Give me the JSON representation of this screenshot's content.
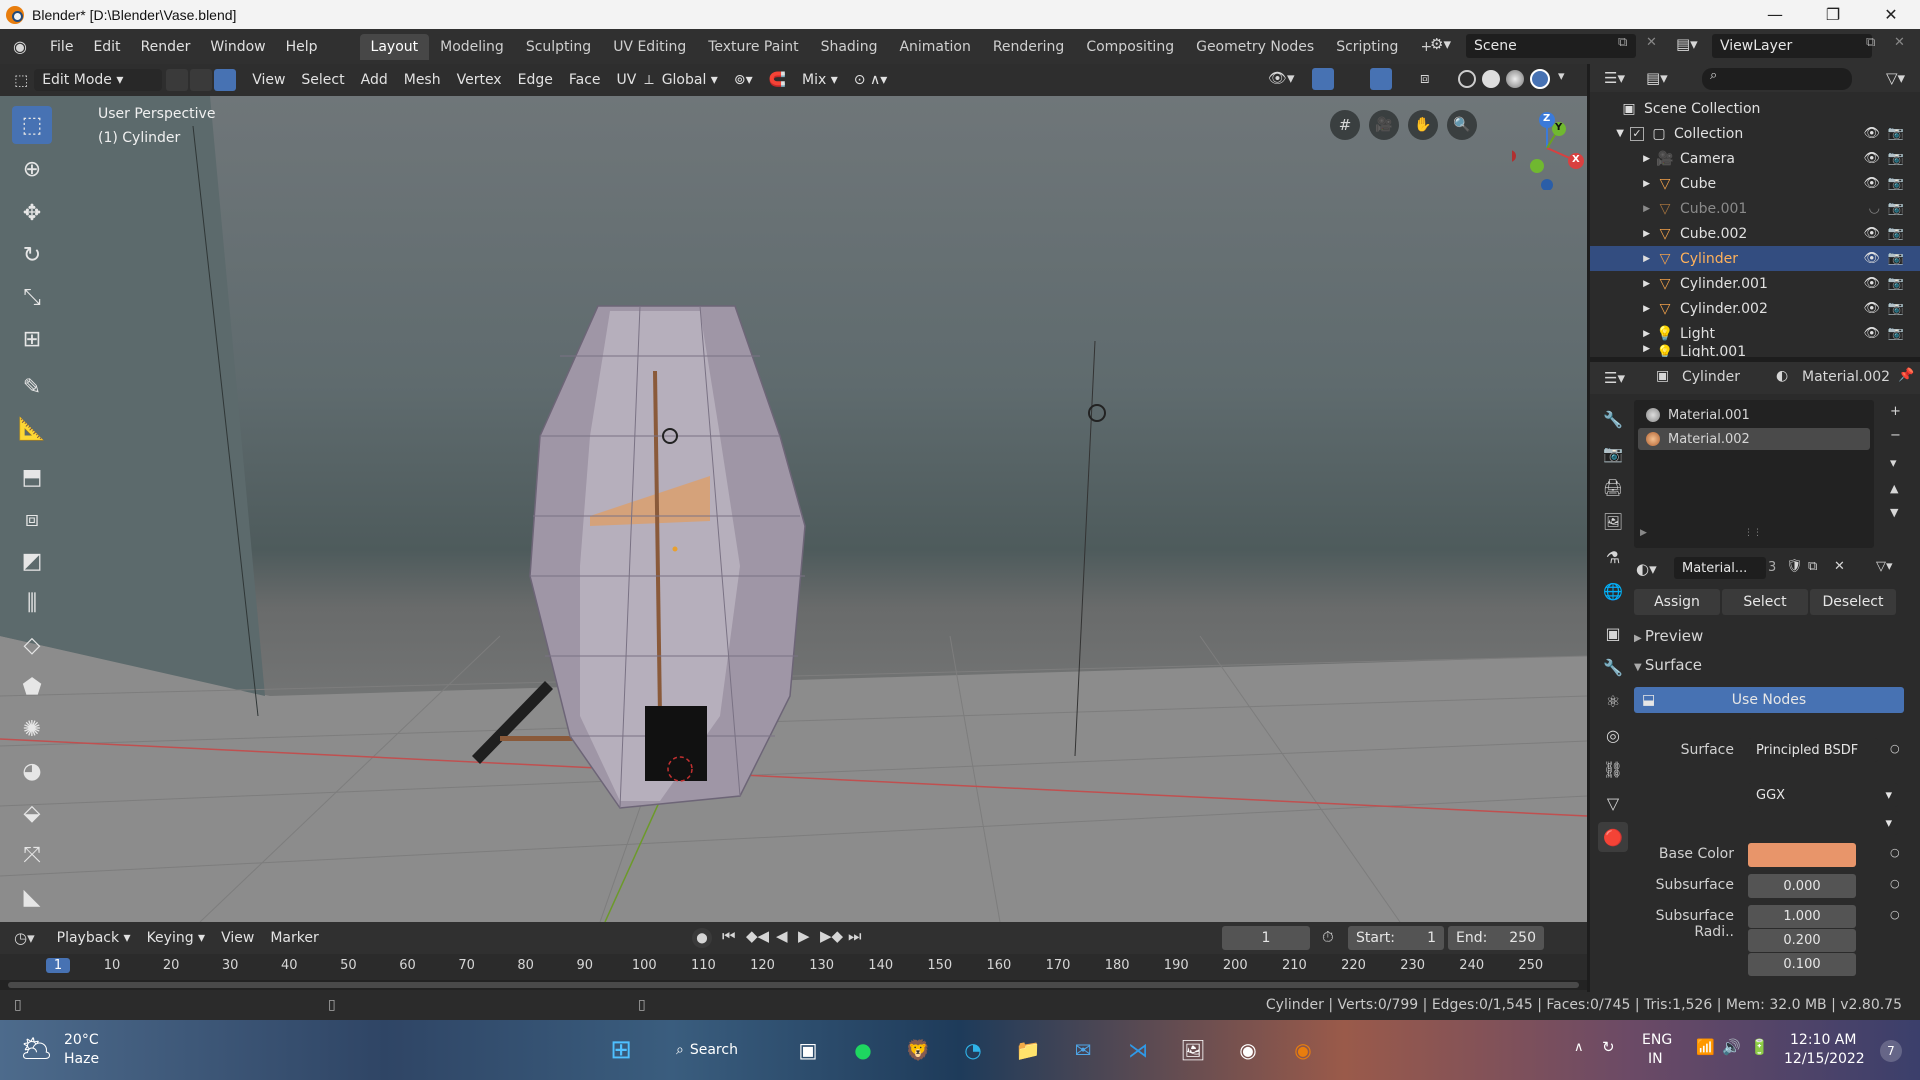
{
  "titlebar": {
    "title": "Blender* [D:\\Blender\\Vase.blend]",
    "minimize": "—",
    "maximize": "❐",
    "close": "✕"
  },
  "menu": [
    "File",
    "Edit",
    "Render",
    "Window",
    "Help"
  ],
  "workspaces": [
    "Layout",
    "Modeling",
    "Sculpting",
    "UV Editing",
    "Texture Paint",
    "Shading",
    "Animation",
    "Rendering",
    "Compositing",
    "Geometry Nodes",
    "Scripting"
  ],
  "add_workspace": "+",
  "scene": {
    "name": "Scene"
  },
  "view_layer": {
    "name": "ViewLayer"
  },
  "editor_header": {
    "mode": "Edit Mode",
    "menus": [
      "View",
      "Select",
      "Add",
      "Mesh",
      "Vertex",
      "Edge",
      "Face",
      "UV"
    ],
    "orientation": "Global",
    "proportional": "Mix"
  },
  "viewport": {
    "perspective": "User Perspective",
    "object": "(1) Cylinder"
  },
  "gizmo": {
    "z": "Z",
    "y": "Y",
    "x": "X"
  },
  "outliner": {
    "search_icon": "search-icon",
    "scene_collection": "Scene Collection",
    "collection": "Collection",
    "items": [
      {
        "name": "Camera",
        "icon": "camera-icon"
      },
      {
        "name": "Cube",
        "icon": "mesh-icon"
      },
      {
        "name": "Cube.001",
        "icon": "mesh-icon"
      },
      {
        "name": "Cube.002",
        "icon": "mesh-icon"
      },
      {
        "name": "Cylinder",
        "icon": "mesh-icon"
      },
      {
        "name": "Cylinder.001",
        "icon": "mesh-icon"
      },
      {
        "name": "Cylinder.002",
        "icon": "mesh-icon"
      },
      {
        "name": "Light",
        "icon": "light-icon"
      },
      {
        "name": "Light.001",
        "icon": "light-icon"
      }
    ]
  },
  "properties": {
    "object": "Cylinder",
    "material": "Material.002",
    "slots": [
      "Material.001",
      "Material.002"
    ],
    "material_field": "Material...",
    "user_count": "3",
    "assign": "Assign",
    "select": "Select",
    "deselect": "Deselect",
    "preview": "Preview",
    "surface_section": "Surface",
    "use_nodes": "Use Nodes",
    "surface_label": "Surface",
    "surface_value": "Principled BSDF",
    "distribution": "GGX",
    "base_color_label": "Base Color",
    "base_color": "#e8956a",
    "subsurface_label": "Subsurface",
    "subsurface_value": "0.000",
    "subsurface_radius_label": "Subsurface Radi..",
    "subsurface_radius": [
      "1.000",
      "0.200",
      "0.100"
    ]
  },
  "timeline": {
    "menus": [
      "Playback",
      "Keying",
      "View",
      "Marker"
    ],
    "current_frame": "1",
    "start_label": "Start:",
    "start": "1",
    "end_label": "End:",
    "end": "250",
    "ruler": [
      "1",
      "10",
      "20",
      "30",
      "40",
      "50",
      "60",
      "70",
      "80",
      "90",
      "100",
      "110",
      "120",
      "130",
      "140",
      "150",
      "160",
      "170",
      "180",
      "190",
      "200",
      "210",
      "220",
      "230",
      "240",
      "250"
    ]
  },
  "statusbar": {
    "info": "Cylinder | Verts:0/799 | Edges:0/1,545 | Faces:0/745 | Tris:1,526 | Mem: 32.0 MB | v2.80.75"
  },
  "taskbar": {
    "weather_temp": "20°C",
    "weather_desc": "Haze",
    "search": "Search",
    "lang": "ENG",
    "region": "IN",
    "time": "12:10 AM",
    "date": "12/15/2022",
    "notif": "7"
  }
}
